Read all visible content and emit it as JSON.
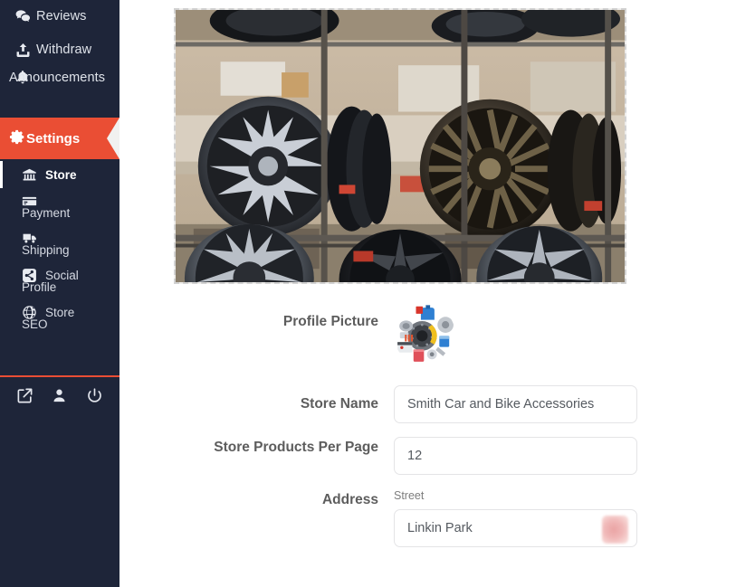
{
  "sidebar": {
    "items": [
      {
        "label": "Reviews",
        "icon": "comments-icon"
      },
      {
        "label": "Withdraw",
        "icon": "upload-icon"
      },
      {
        "label": "Announcements",
        "icon": "bell-icon"
      }
    ],
    "active_item": {
      "label": "Settings",
      "icon": "gear-icon",
      "color": "#ea4e34"
    },
    "sub_items": [
      {
        "label": "Store",
        "label2": "",
        "icon": "bank-icon",
        "active": true
      },
      {
        "label": "Payment",
        "label2": "",
        "icon": "credit-card-icon",
        "active": false
      },
      {
        "label": "Shipping",
        "label2": "",
        "icon": "truck-icon",
        "active": false
      },
      {
        "label": "Social",
        "label2": "Profile",
        "icon": "share-icon",
        "active": false
      },
      {
        "label": "Store",
        "label2": "SEO",
        "icon": "globe-icon",
        "active": false
      }
    ],
    "bottom_icons": [
      {
        "name": "external-link-icon"
      },
      {
        "name": "user-icon"
      },
      {
        "name": "power-icon"
      }
    ],
    "background_color": "#1e2539",
    "accent_color": "#ea4e34"
  },
  "main": {
    "banner": {
      "alt": "store-banner-car-wheels",
      "name": "banner-upload-area"
    },
    "fields": {
      "profile_picture": {
        "label": "Profile Picture",
        "image_alt": "auto-parts-collage-avatar"
      },
      "store_name": {
        "label": "Store Name",
        "value": "Smith Car and Bike Accessories",
        "placeholder": "Store Name"
      },
      "products_per_page": {
        "label": "Store Products Per Page",
        "value": "12",
        "placeholder": "12"
      },
      "address": {
        "label": "Address",
        "street": {
          "sublabel": "Street",
          "value": "Linkin Park",
          "placeholder": "Street"
        }
      }
    }
  }
}
